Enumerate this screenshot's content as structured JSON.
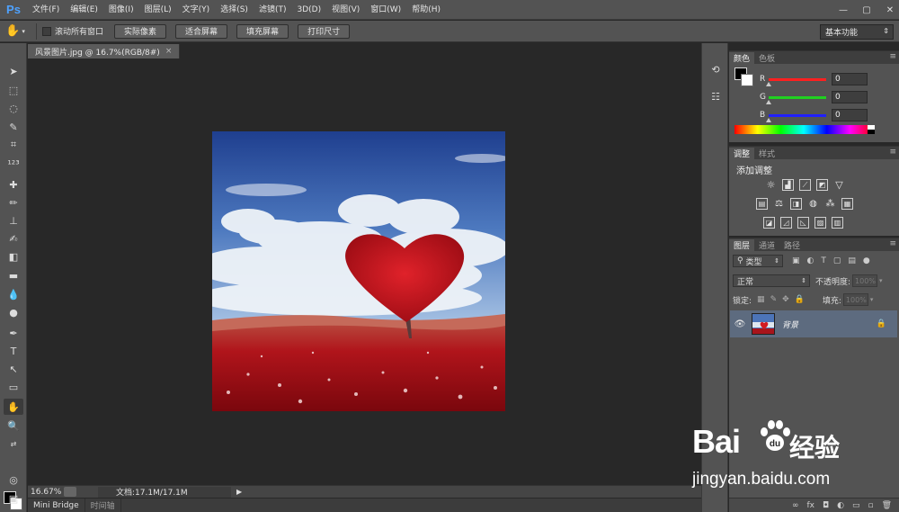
{
  "app": {
    "logo": "Ps"
  },
  "menu": [
    "文件(F)",
    "编辑(E)",
    "图像(I)",
    "图层(L)",
    "文字(Y)",
    "选择(S)",
    "滤镜(T)",
    "3D(D)",
    "视图(V)",
    "窗口(W)",
    "帮助(H)"
  ],
  "window_controls": {
    "minimize": "—",
    "restore": "▢",
    "close": "✕"
  },
  "options": {
    "tool_icon": "hand-icon",
    "scroll_all_label": "滚动所有窗口",
    "buttons": [
      "实际像素",
      "适合屏幕",
      "填充屏幕",
      "打印尺寸"
    ],
    "workspace": "基本功能"
  },
  "document": {
    "tab_title": "风景图片.jpg @ 16.7%(RGB/8#)",
    "close": "×"
  },
  "status": {
    "zoom": "16.67%",
    "doc_info": "文档:17.1M/17.1M",
    "arrow": "▶"
  },
  "bottom_tabs": [
    "Mini Bridge",
    "时间轴"
  ],
  "color_panel": {
    "tabs": [
      "颜色",
      "色板"
    ],
    "channels": [
      {
        "name": "R",
        "value": "0",
        "color": "#ff2020"
      },
      {
        "name": "G",
        "value": "0",
        "color": "#20d020"
      },
      {
        "name": "B",
        "value": "0",
        "color": "#2020ff"
      }
    ],
    "foreground": "#000000",
    "background": "#ffffff"
  },
  "adjust_panel": {
    "tabs": [
      "调整",
      "样式"
    ],
    "title": "添加调整"
  },
  "layers_panel": {
    "tabs": [
      "图层",
      "通道",
      "路径"
    ],
    "filter_kind": "类型",
    "blend_mode": "正常",
    "opacity_label": "不透明度:",
    "opacity_value": "100%",
    "lock_label": "锁定:",
    "fill_label": "填充:",
    "fill_value": "100%",
    "layer_name": "背景"
  },
  "watermark": {
    "logo_text": "Bai",
    "cn_text": "经验",
    "url": "jingyan.baidu.com"
  }
}
